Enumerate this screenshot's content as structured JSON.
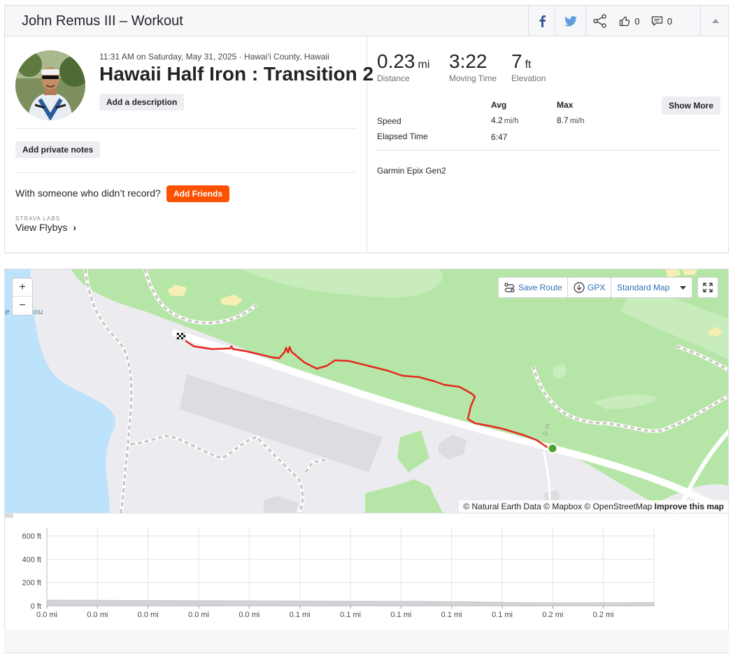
{
  "header": {
    "title": "John Remus III – Workout",
    "kudos_count": "0",
    "comments_count": "0"
  },
  "activity": {
    "meta": "11:31 AM on Saturday, May 31, 2025 · Hawaiʻi County, Hawaii",
    "title": "Hawaii Half Iron : Transition 2",
    "add_description": "Add a description",
    "add_private_notes": "Add private notes",
    "with_someone": "With someone who didn’t record?",
    "add_friends": "Add Friends",
    "labs": "STRAVA LABS",
    "view_flybys": "View Flybys",
    "view_flybys_chevron": "›"
  },
  "stats": {
    "distance_value": "0.23",
    "distance_unit": "mi",
    "distance_label": "Distance",
    "moving_time_value": "3:22",
    "moving_time_label": "Moving Time",
    "elevation_value": "7",
    "elevation_unit": "ft",
    "elevation_label": "Elevation",
    "col_avg": "Avg",
    "col_max": "Max",
    "show_more": "Show More",
    "speed_label": "Speed",
    "speed_avg": "4.2",
    "speed_avg_unit": "mi/h",
    "speed_max": "8.7",
    "speed_max_unit": "mi/h",
    "elapsed_label": "Elapsed Time",
    "elapsed_avg": "6:47",
    "device": "Garmin Epix Gen2"
  },
  "map": {
    "zoom_in": "+",
    "zoom_out": "−",
    "save_route": "Save Route",
    "gpx": "GPX",
    "map_style": "Standard Map",
    "place_label": "e Kanipou",
    "scale_label": "0 m",
    "attribution": "© Natural Earth Data © Mapbox © OpenStreetMap",
    "improve": "Improve this map",
    "colors": {
      "route": "#e5271f",
      "start": "#49a52b",
      "water": "#bde2fb",
      "park": "#b6e6a7"
    }
  },
  "chart_data": {
    "type": "area",
    "y_ticks": [
      "600 ft",
      "400 ft",
      "200 ft",
      "0 ft"
    ],
    "y_tick_values": [
      600,
      400,
      200,
      0
    ],
    "x_ticks": [
      "0.0 mi",
      "0.0 mi",
      "0.0 mi",
      "0.0 mi",
      "0.0 mi",
      "0.1 mi",
      "0.1 mi",
      "0.1 mi",
      "0.1 mi",
      "0.1 mi",
      "0.2 mi",
      "0.2 mi"
    ],
    "ylim": [
      0,
      600
    ],
    "x": [
      0,
      0.02,
      0.04,
      0.06,
      0.08,
      0.1,
      0.12,
      0.14,
      0.16,
      0.18,
      0.2,
      0.22,
      0.23
    ],
    "elevation_ft": [
      60,
      58,
      55,
      53,
      50,
      48,
      45,
      42,
      38,
      24,
      22,
      24,
      30
    ],
    "grid": true
  }
}
